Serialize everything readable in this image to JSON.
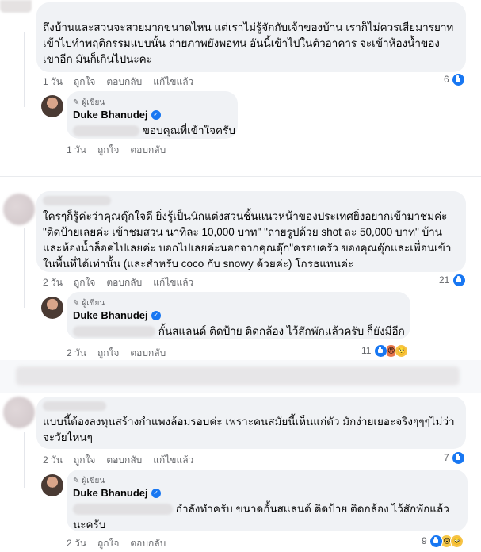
{
  "comments": [
    {
      "text": "ถึงบ้านและสวนจะสวยมากขนาดไหน แต่เราไม่รู้จักกับเจ้าของบ้าน เราก็ไม่ควรเสียมารยาท เข้าไปทำพฤติกรรมแบบนั้น ถ่ายภาพยังพอทน อันนี้เข้าไปในตัวอาคาร จะเข้าห้องน้ำของเขาอีก มันก็เกินไปนะคะ",
      "actions": {
        "time": "1 วัน",
        "like": "ถูกใจ",
        "reply": "ตอบกลับ",
        "edited": "แก้ไขแล้ว"
      },
      "reaction_count": "6",
      "reply": {
        "badge": "ผู้เขียน",
        "author": "Duke Bhanudej",
        "text": "ขอบคุณที่เข้าใจครับ",
        "actions": {
          "time": "1 วัน",
          "like": "ถูกใจ",
          "reply": "ตอบกลับ"
        }
      }
    },
    {
      "text": "ใครๆก็รู้ค่ะว่าคุณดุ๊กใจดี ยิ่งรู้เป็นนักแต่งสวนชั้นแนวหน้าของประเทศยิ่งอยากเข้ามาชมค่ะ \"ติดป้ายเลยค่ะ เข้าชมสวน นาทีละ 10,000 บาท\" \"ถ่ายรูปด้วย shot ละ 50,000 บาท\" บ้านและห้องน้ำล็อคไปเลยค่ะ บอกไปเลยค่ะนอกจากคุณดุ๊ก\"ครอบครัว ของคุณดุ๊กและเพื่อนเข้าในพื้นที่ได้เท่านั้น (และสำหรับ coco กับ snowy ด้วยค่ะ) โกรธแทนค่ะ",
      "actions": {
        "time": "2 วัน",
        "like": "ถูกใจ",
        "reply": "ตอบกลับ",
        "edited": "แก้ไขแล้ว"
      },
      "reaction_count": "21",
      "reply": {
        "badge": "ผู้เขียน",
        "author": "Duke Bhanudej",
        "text": "กั้นสแลนด์ ติดป้าย ติดกล้อง ไว้สักพักแล้วครับ ก็ยังมีอีก",
        "actions": {
          "time": "2 วัน",
          "like": "ถูกใจ",
          "reply": "ตอบกลับ"
        },
        "reaction_count": "11"
      }
    },
    {
      "text": "แบบนี้ต้องลงทุนสร้างกำแพงล้อมรอบค่ะ เพราะคนสมัยนี้เห็นแก่ตัว มักง่ายเยอะจริงๆๆๆไม่ว่าจะวัยไหนๆ",
      "actions": {
        "time": "2 วัน",
        "like": "ถูกใจ",
        "reply": "ตอบกลับ",
        "edited": "แก้ไขแล้ว"
      },
      "reaction_count": "7",
      "reply": {
        "badge": "ผู้เขียน",
        "author": "Duke Bhanudej",
        "text": "กำลังทำครับ ขนาดกั้นสแลนด์ ติดป้าย ติดกล้อง ไว้สักพักแล้วนะครับ",
        "actions": {
          "time": "2 วัน",
          "like": "ถูกใจ",
          "reply": "ตอบกลับ"
        },
        "reaction_count": "9"
      }
    }
  ],
  "icons": {
    "like": "like-icon",
    "angry": "angry-icon",
    "care": "care-icon",
    "haha": "haha-icon",
    "verified": "verified-badge-icon",
    "author_badge": "pen-icon"
  },
  "colors": {
    "bubble": "#f0f2f5",
    "like_blue": "#1877f2",
    "muted": "#65676b"
  }
}
